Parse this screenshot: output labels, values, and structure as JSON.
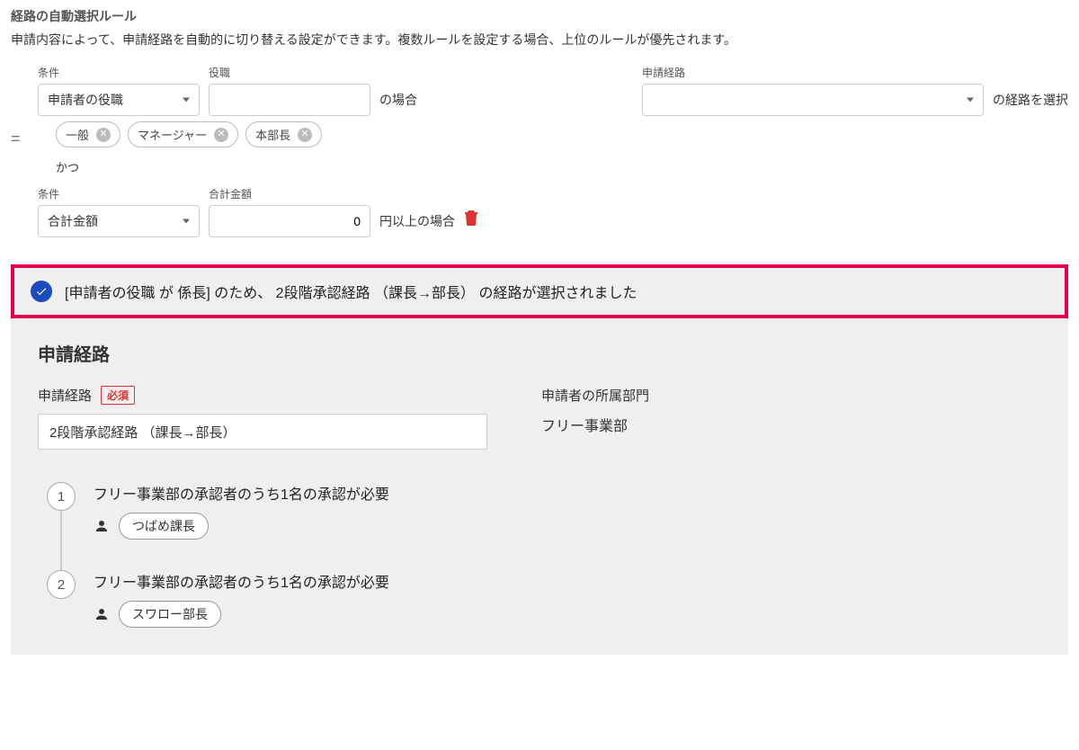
{
  "header": {
    "title": "経路の自動選択ルール",
    "description": "申請内容によって、申請経路を自動的に切り替える設定ができます。複数ルールを設定する場合、上位のルールが優先されます。"
  },
  "rule": {
    "handle": "=",
    "row1": {
      "condition_label": "条件",
      "condition_value": "申請者の役職",
      "position_label": "役職",
      "position_value": "",
      "suffix": "の場合",
      "route_label": "申請経路",
      "route_value": "",
      "route_suffix": "の経路を選択"
    },
    "chips": [
      "一般",
      "マネージャー",
      "本部長"
    ],
    "and_label": "かつ",
    "row2": {
      "condition_label": "条件",
      "condition_value": "合計金額",
      "amount_label": "合計金額",
      "amount_value": "0",
      "suffix": "円以上の場合"
    }
  },
  "alert": {
    "text": "[申請者の役職 が 係長] のため、 2段階承認経路 （課長→部長） の経路が選択されました"
  },
  "panel": {
    "title": "申請経路",
    "route_label": "申請経路",
    "required": "必須",
    "route_value": "2段階承認経路 （課長→部長）",
    "dept_label": "申請者の所属部門",
    "dept_value": "フリー事業部",
    "steps": [
      {
        "num": "1",
        "title": "フリー事業部の承認者のうち1名の承認が必要",
        "approver": "つばめ課長"
      },
      {
        "num": "2",
        "title": "フリー事業部の承認者のうち1名の承認が必要",
        "approver": "スワロー部長"
      }
    ]
  }
}
